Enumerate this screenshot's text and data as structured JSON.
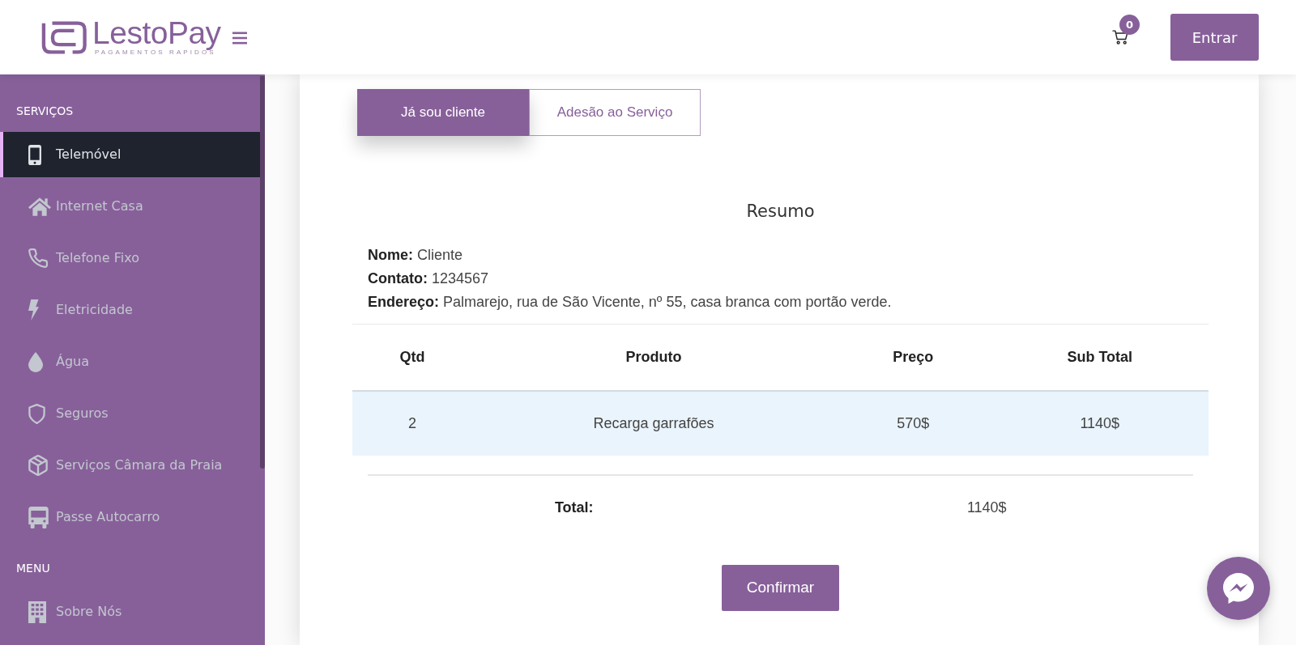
{
  "header": {
    "logo": {
      "name": "LestoPay",
      "tagline": "PAGAMENTOS RAPIDOS"
    },
    "cart": {
      "count": "0"
    },
    "login_button": "Entrar"
  },
  "sidebar": {
    "sections": [
      {
        "title": "SERVIÇOS",
        "items": [
          {
            "label": "Telemóvel",
            "selected": true
          },
          {
            "label": "Internet Casa",
            "selected": false
          },
          {
            "label": "Telefone Fixo",
            "selected": false
          },
          {
            "label": "Eletricidade",
            "selected": false
          },
          {
            "label": "Água",
            "selected": false
          },
          {
            "label": "Seguros",
            "selected": false
          },
          {
            "label": "Serviços Câmara da Praia",
            "selected": false
          },
          {
            "label": "Passe Autocarro",
            "selected": false
          }
        ]
      },
      {
        "title": "MENU",
        "items": [
          {
            "label": "Sobre Nós",
            "selected": false
          }
        ]
      }
    ]
  },
  "tabs": [
    {
      "label": "Já sou cliente",
      "selected": true
    },
    {
      "label": "Adesão ao Serviço",
      "selected": false
    }
  ],
  "summary": {
    "title": "Resumo",
    "lines": [
      "**Nome:** Cliente",
      "**Contato:** 1234567",
      "**Endereço:** Palmarejo, rua de São Vicente, nº 55, casa branca com portão verde."
    ]
  },
  "table": {
    "columns": [
      "Qtd",
      "Produto",
      "Preço",
      "Sub Total"
    ],
    "rows": [
      [
        "2",
        "Recarga garrafões",
        "570$",
        "1140$"
      ]
    ]
  },
  "total": {
    "label": "Total:",
    "value": "1140$"
  },
  "confirm_button": "Confirmar"
}
